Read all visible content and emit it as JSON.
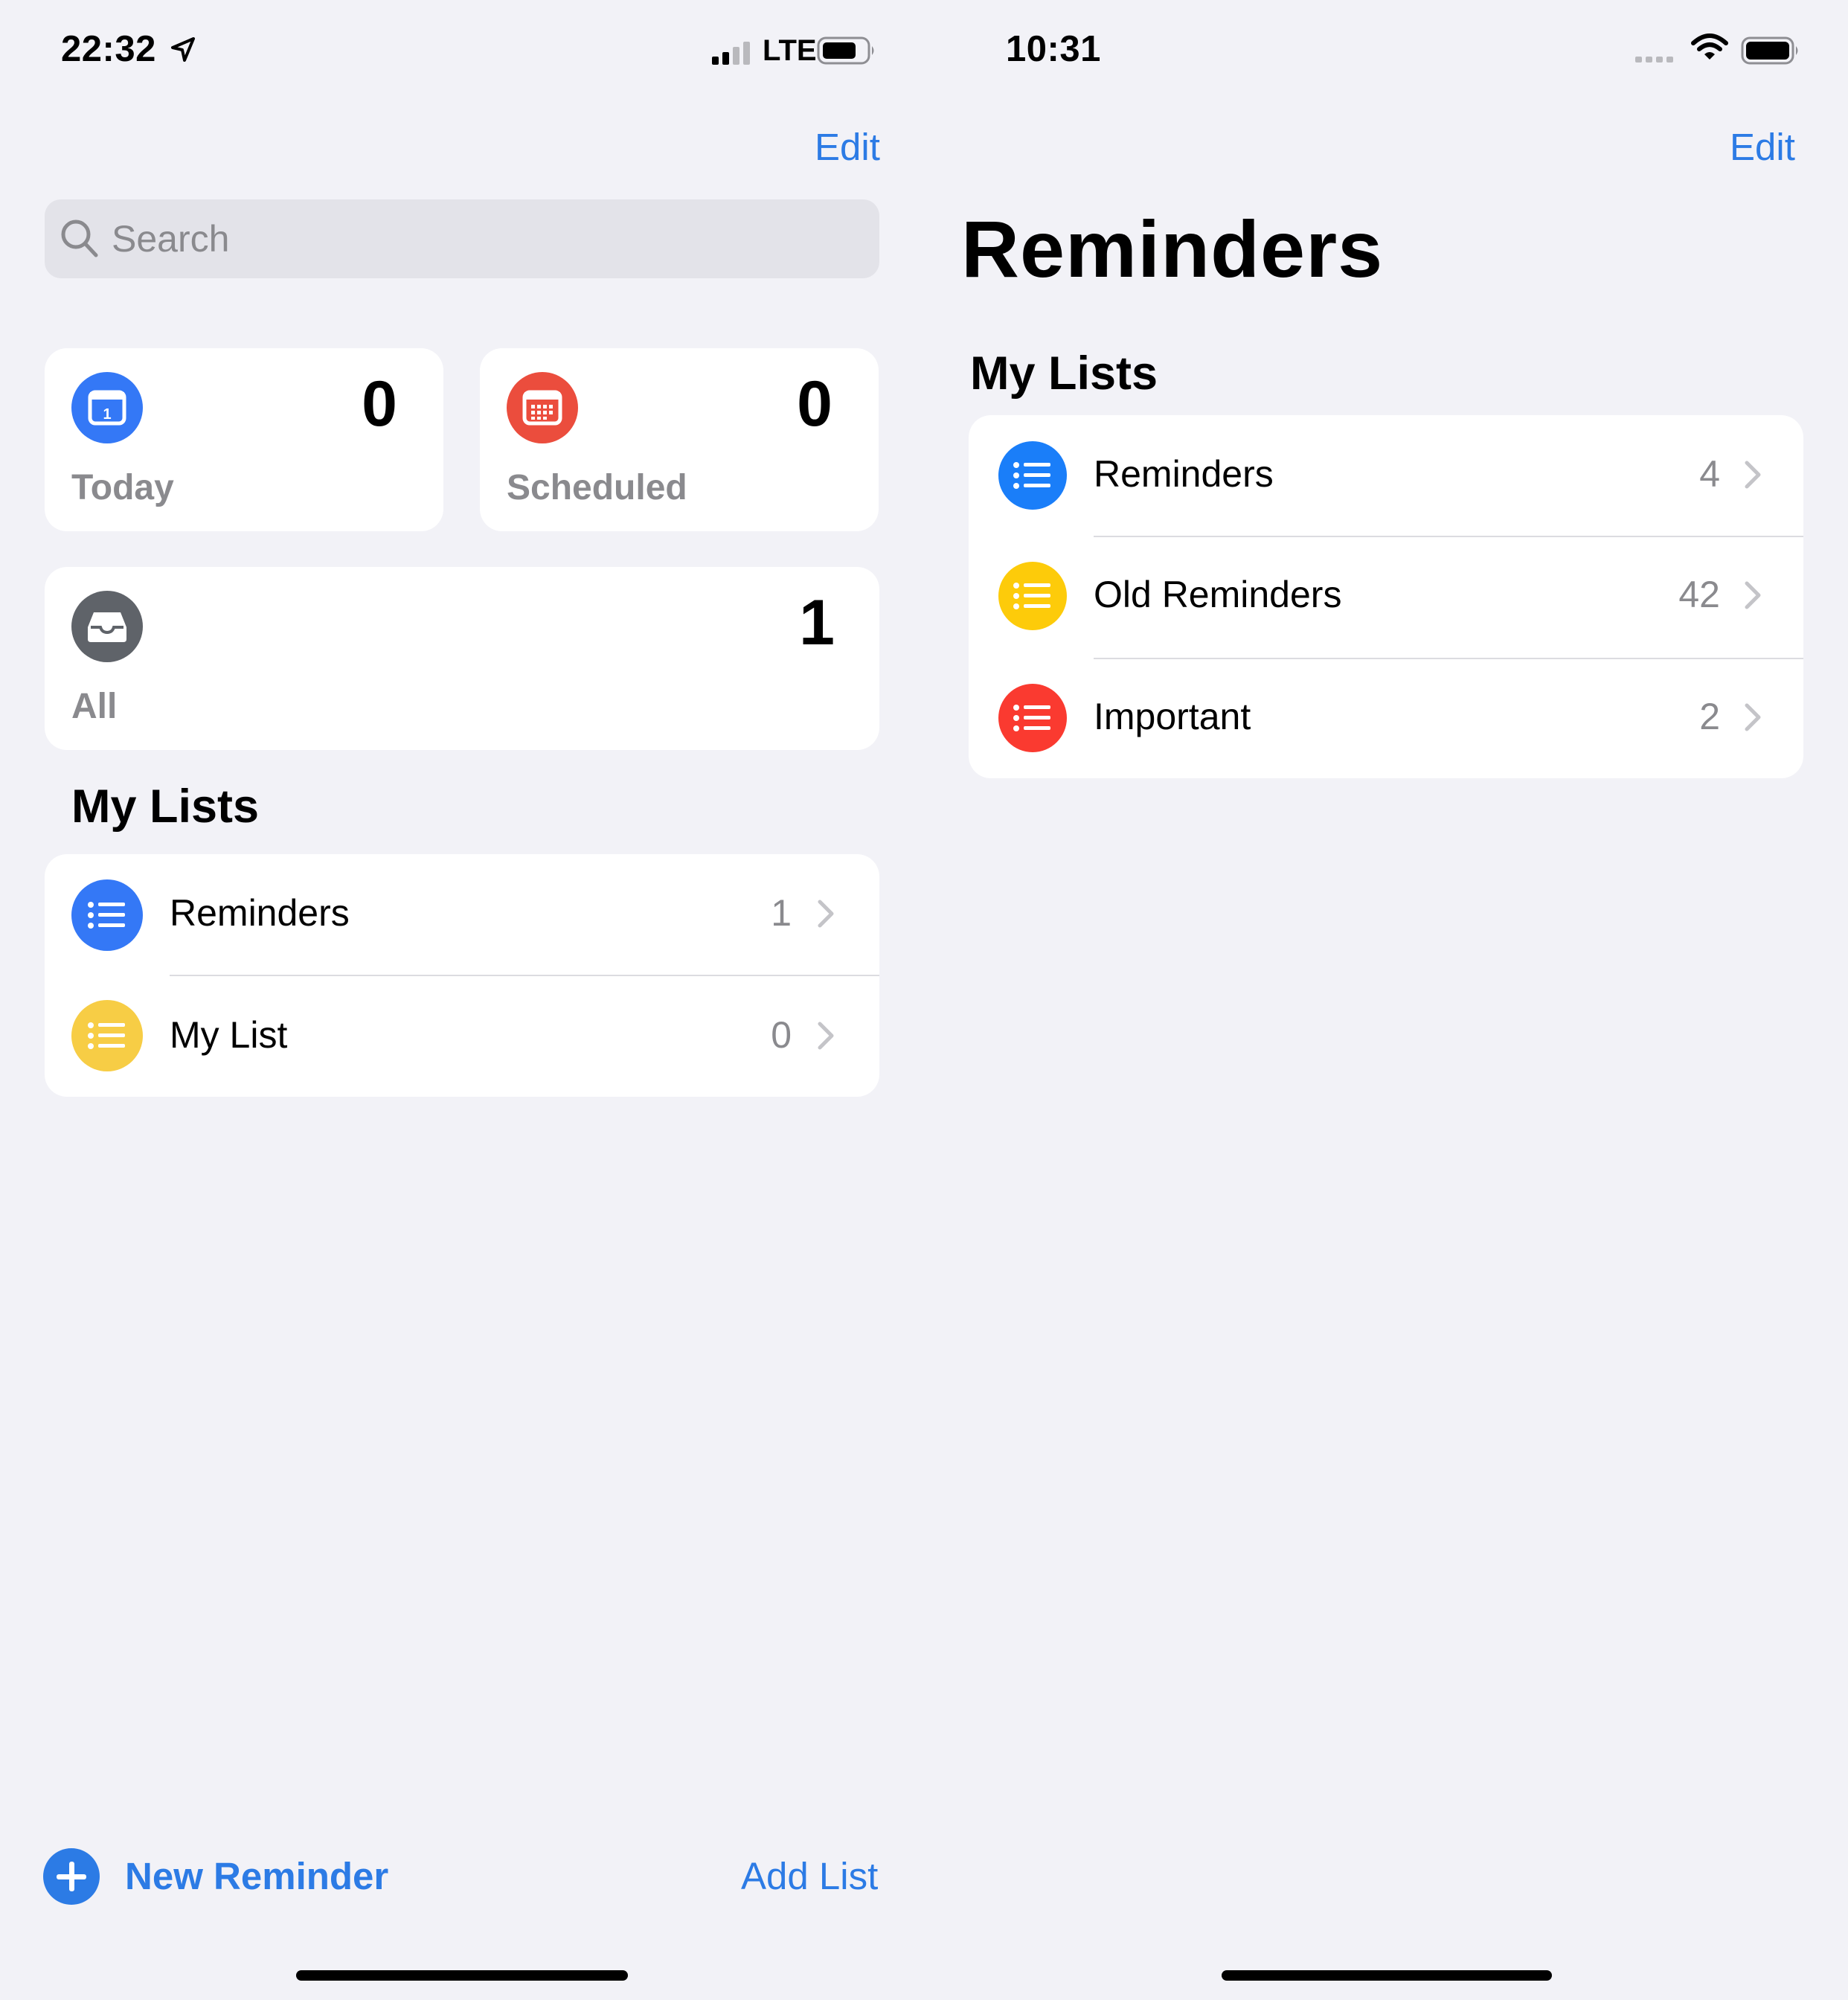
{
  "colors": {
    "background": "#f2f2f7",
    "accent": "#2c7be5",
    "blue": "#3478f6",
    "red": "#eb4d3d",
    "gray_icon": "#5f6369",
    "yellow": "#f7cd45",
    "blue_right": "#1a7ef9",
    "yellow_right": "#fdcb0a",
    "red_right": "#fa3a30"
  },
  "left": {
    "status": {
      "time": "22:32",
      "network": "LTE",
      "icons": [
        "location-arrow-icon",
        "cellular-signal-icon",
        "battery-icon"
      ]
    },
    "edit_label": "Edit",
    "search": {
      "placeholder": "Search",
      "icon": "search-icon"
    },
    "smart_lists": [
      {
        "label": "Today",
        "count": "0",
        "icon": "calendar-today-icon"
      },
      {
        "label": "Scheduled",
        "count": "0",
        "icon": "calendar-grid-icon"
      },
      {
        "label": "All",
        "count": "1",
        "icon": "inbox-tray-icon"
      }
    ],
    "section_title": "My Lists",
    "lists": [
      {
        "label": "Reminders",
        "count": "1"
      },
      {
        "label": "My List",
        "count": "0"
      }
    ],
    "toolbar": {
      "new_reminder": "New Reminder",
      "add_list": "Add List"
    }
  },
  "right": {
    "status": {
      "time": "10:31",
      "icons": [
        "cellular-signal-icon",
        "wifi-icon",
        "battery-icon"
      ]
    },
    "edit_label": "Edit",
    "title": "Reminders",
    "section_title": "My Lists",
    "lists": [
      {
        "label": "Reminders",
        "count": "4"
      },
      {
        "label": "Old Reminders",
        "count": "42"
      },
      {
        "label": "Important",
        "count": "2"
      }
    ]
  }
}
